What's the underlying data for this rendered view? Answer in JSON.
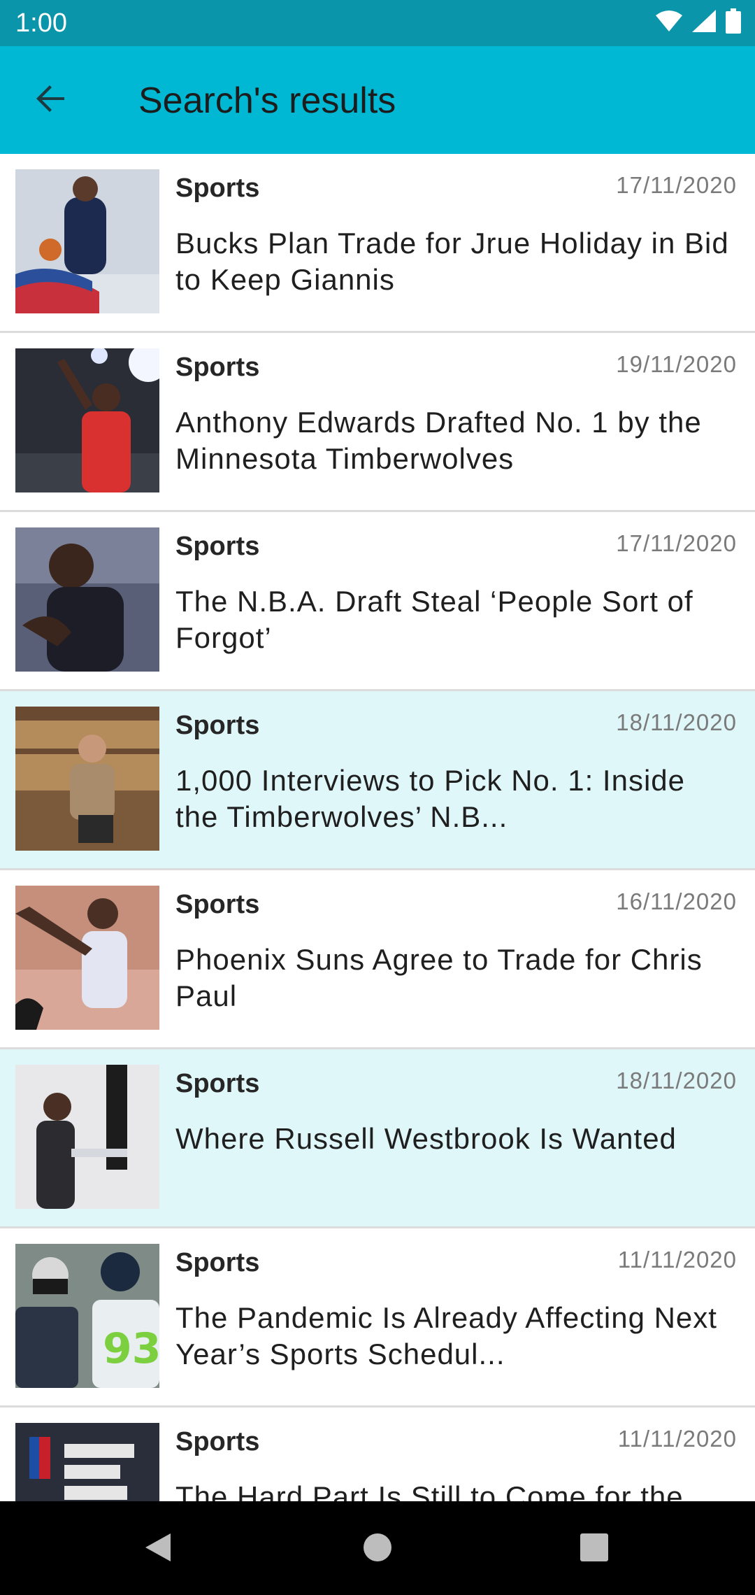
{
  "status_bar": {
    "time": "1:00",
    "icons": [
      "wifi-icon",
      "signal-icon",
      "battery-icon"
    ]
  },
  "app_bar": {
    "back_icon": "arrow-back-icon",
    "title": "Search's results"
  },
  "results": [
    {
      "category": "Sports",
      "date": "17/11/2020",
      "title": "Bucks Plan Trade for Jrue Holiday in Bid to Keep Giannis",
      "highlighted": false
    },
    {
      "category": "Sports",
      "date": "19/11/2020",
      "title": "Anthony Edwards Drafted No. 1 by the Minnesota Timberwolves",
      "highlighted": false
    },
    {
      "category": "Sports",
      "date": "17/11/2020",
      "title": "The N.B.A. Draft Steal ‘People Sort of Forgot’",
      "highlighted": false
    },
    {
      "category": "Sports",
      "date": "18/11/2020",
      "title": "1,000 Interviews to Pick No. 1: Inside the Timberwolves’ N.B...",
      "highlighted": true
    },
    {
      "category": "Sports",
      "date": "16/11/2020",
      "title": "Phoenix Suns Agree to Trade for Chris Paul",
      "highlighted": false
    },
    {
      "category": "Sports",
      "date": "18/11/2020",
      "title": "Where Russell Westbrook Is Wanted",
      "highlighted": true
    },
    {
      "category": "Sports",
      "date": "11/11/2020",
      "title": "The Pandemic Is Already Affecting Next Year’s Sports Schedul...",
      "highlighted": false
    },
    {
      "category": "Sports",
      "date": "11/11/2020",
      "title": "The Hard Part Is Still to Come for the",
      "highlighted": false
    }
  ],
  "nav_bar": {
    "icons": [
      "back-triangle-icon",
      "home-circle-icon",
      "recents-square-icon"
    ]
  },
  "colors": {
    "status_bar": "#0a95ab",
    "app_bar": "#00b8d4",
    "highlight_row": "#e0f7fa",
    "nav_bar": "#000000"
  }
}
